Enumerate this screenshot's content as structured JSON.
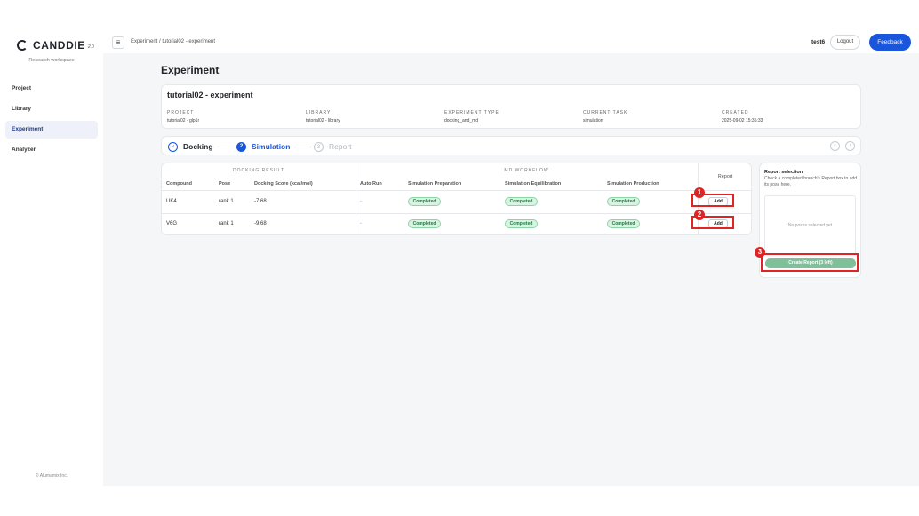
{
  "app": {
    "name": "CANDDIE",
    "version": "2.0",
    "workspace": "Research workspace",
    "copyright": "© Alumamix Inc."
  },
  "sidebar": {
    "items": [
      {
        "label": "Project"
      },
      {
        "label": "Library"
      },
      {
        "label": "Experiment",
        "active": true
      },
      {
        "label": "Analyzer"
      }
    ]
  },
  "topbar": {
    "breadcrumb": "Experiment / tutorial02 - experiment",
    "user": "test6",
    "logout_label": "Logout",
    "feedback_label": "Feedback",
    "menu_icon": "≡"
  },
  "page": {
    "title": "Experiment"
  },
  "experiment": {
    "name": "tutorial02 - experiment",
    "meta": [
      {
        "label": "PROJECT",
        "value": "tutorial02 - glp1r"
      },
      {
        "label": "LIBRARY",
        "value": "tutorial02 - library"
      },
      {
        "label": "EXPERIMENT TYPE",
        "value": "docking_and_md"
      },
      {
        "label": "CURRENT TASK",
        "value": "simulation"
      },
      {
        "label": "CREATED",
        "value": "2025-09-02 15:35:33"
      }
    ]
  },
  "steps": [
    {
      "label": "Docking",
      "icon": "✓",
      "state": "done"
    },
    {
      "label": "Simulation",
      "icon": "2",
      "state": "active"
    },
    {
      "label": "Report",
      "icon": "3",
      "state": "todo"
    }
  ],
  "pager": {
    "prev": "‹",
    "next": "›"
  },
  "table": {
    "groups": {
      "docking": "DOCKING RESULT",
      "md": "MD WORKFLOW",
      "report": "Report"
    },
    "columns": [
      "Compound",
      "Pose",
      "Docking Score (kcal/mol)",
      "Auto Run",
      "Simulation Preparation",
      "Simulation Equilibration",
      "Simulation Production"
    ],
    "rows": [
      {
        "compound": "UK4",
        "pose": "rank 1",
        "score": "-7.68",
        "auto_run": "-",
        "prep": "Completed",
        "equil": "Completed",
        "prod": "Completed",
        "report": "Add"
      },
      {
        "compound": "V6G",
        "pose": "rank 1",
        "score": "-9.68",
        "auto_run": "-",
        "prep": "Completed",
        "equil": "Completed",
        "prod": "Completed",
        "report": "Add"
      }
    ]
  },
  "report_panel": {
    "title": "Report selection",
    "help": "Check a completed branch's Report box to add its pose here.",
    "empty": "No poses selected yet",
    "create_label": "Create Report (3 left)"
  },
  "annotations": [
    "1",
    "2",
    "3"
  ],
  "colors": {
    "primary": "#1a56db",
    "success_bg": "#d9f3e2",
    "success_text": "#1e7b3d",
    "highlight": "#e02424",
    "create_btn": "#7fbf9a"
  }
}
